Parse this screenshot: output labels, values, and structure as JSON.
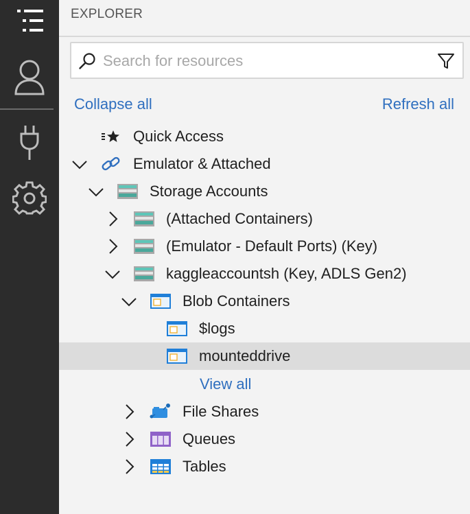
{
  "activity_bar": {
    "items": [
      {
        "name": "explorer-icon"
      },
      {
        "name": "account-icon"
      },
      {
        "name": "plug-icon"
      },
      {
        "name": "gear-icon"
      }
    ]
  },
  "explorer": {
    "title": "EXPLORER",
    "search": {
      "placeholder": "Search for resources",
      "value": ""
    },
    "collapse_all": "Collapse all",
    "refresh_all": "Refresh all",
    "tree": [
      {
        "label": "Quick Access",
        "icon": "quick-access-icon",
        "expanded": null
      },
      {
        "label": "Emulator & Attached",
        "icon": "link-icon",
        "expanded": true
      },
      {
        "label": "Storage Accounts",
        "icon": "storage-account-icon",
        "expanded": true
      },
      {
        "label": "(Attached Containers)",
        "icon": "storage-account-icon",
        "expanded": false
      },
      {
        "label": "(Emulator - Default Ports) (Key)",
        "icon": "storage-account-icon",
        "expanded": false
      },
      {
        "label": "kaggleaccountsh (Key, ADLS Gen2)",
        "icon": "storage-account-icon",
        "expanded": true
      },
      {
        "label": "Blob Containers",
        "icon": "blob-container-icon",
        "expanded": true
      },
      {
        "label": "$logs",
        "icon": "blob-container-icon",
        "expanded": null
      },
      {
        "label": "mounteddrive",
        "icon": "blob-container-icon",
        "expanded": null,
        "selected": true
      },
      {
        "label": "File Shares",
        "icon": "file-share-icon",
        "expanded": false
      },
      {
        "label": "Queues",
        "icon": "queue-icon",
        "expanded": false
      },
      {
        "label": "Tables",
        "icon": "table-icon",
        "expanded": false
      }
    ],
    "view_all": "View all"
  },
  "colors": {
    "activity_bar": "#2c2c2c",
    "panel": "#f3f3f3",
    "link": "#2f6fbf",
    "selected_row": "#dcdcdc"
  }
}
